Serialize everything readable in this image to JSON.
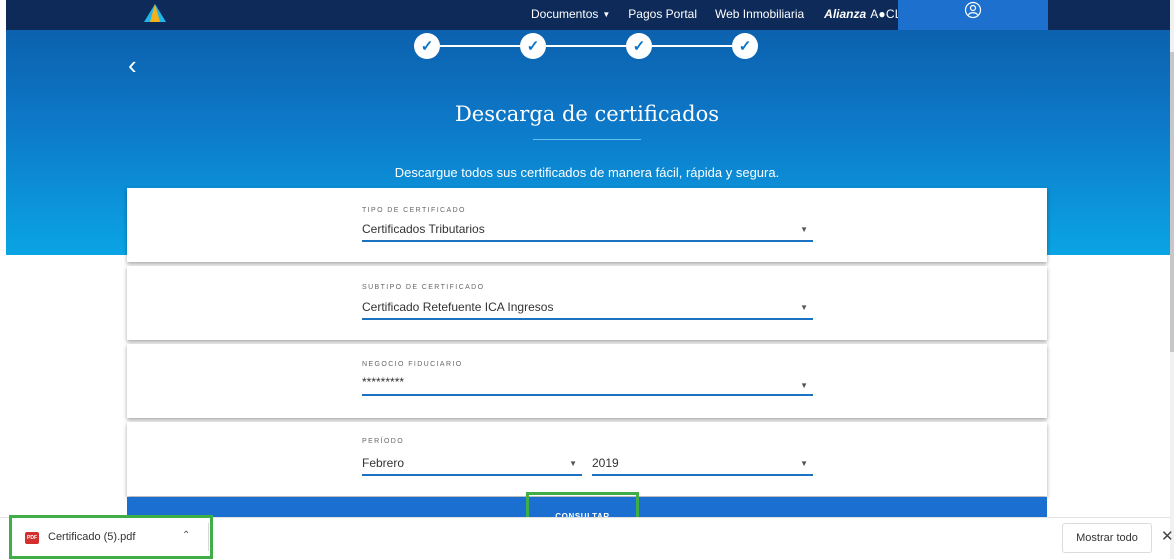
{
  "nav": {
    "items": [
      {
        "label": "Documentos",
        "has_caret": true
      },
      {
        "label": "Pagos Portal",
        "has_caret": false
      },
      {
        "label": "Web Inmobiliaria",
        "has_caret": false
      }
    ],
    "brand_bold": "Alianza",
    "brand_click": "A●CLICK",
    "user_icon": "user-icon"
  },
  "steps": {
    "count": 4,
    "check_glyph": "✓"
  },
  "back_glyph": "‹",
  "title": "Descarga de certificados",
  "subtitle": "Descargue todos sus certificados de manera fácil, rápida y segura.",
  "form": {
    "tipo": {
      "label": "TIPO DE CERTIFICADO",
      "value": "Certificados Tributarios"
    },
    "subtipo": {
      "label": "SUBTIPO DE CERTIFICADO",
      "value": "Certificado Retefuente ICA Ingresos"
    },
    "negocio": {
      "label": "NEGOCIO FIDUCIARIO",
      "value": "*********"
    },
    "periodo": {
      "label": "PERÍODO",
      "month": "Febrero",
      "year": "2019"
    }
  },
  "consult_label": "CONSULTAR",
  "download": {
    "file_name": "Certificado (5).pdf",
    "icon_text": "PDF",
    "show_all": "Mostrar todo",
    "close_glyph": "✕"
  },
  "colors": {
    "nav_bg": "#0e2a58",
    "accent": "#1a72c0",
    "highlight": "#3fae49"
  }
}
